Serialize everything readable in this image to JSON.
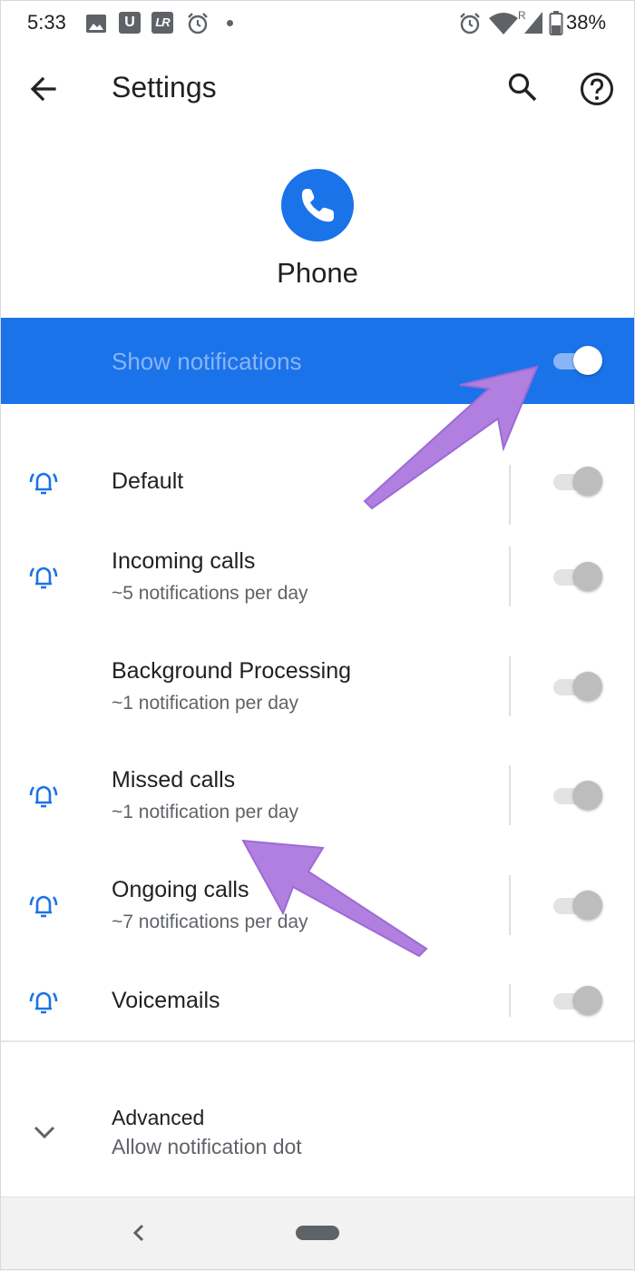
{
  "status_bar": {
    "time": "5:33",
    "icon_u": "U",
    "icon_lr": "LR",
    "roaming": "R",
    "battery": "38%"
  },
  "toolbar": {
    "title": "Settings"
  },
  "app": {
    "name": "Phone",
    "accent": "#1a73e8"
  },
  "master": {
    "label": "Show notifications",
    "on": true
  },
  "channels": [
    {
      "title": "Default",
      "subtitle": "",
      "bell": true,
      "enabled": false
    },
    {
      "title": "Incoming calls",
      "subtitle": "~5 notifications per day",
      "bell": true,
      "enabled": false
    },
    {
      "title": "Background Processing",
      "subtitle": "~1 notification per day",
      "bell": false,
      "enabled": false
    },
    {
      "title": "Missed calls",
      "subtitle": "~1 notification per day",
      "bell": true,
      "enabled": false
    },
    {
      "title": "Ongoing calls",
      "subtitle": "~7 notifications per day",
      "bell": true,
      "enabled": false
    },
    {
      "title": "Voicemails",
      "subtitle": "",
      "bell": true,
      "enabled": false
    }
  ],
  "advanced": {
    "title": "Advanced",
    "subtitle": "Allow notification dot"
  },
  "annotation_color": "#b07fe0"
}
